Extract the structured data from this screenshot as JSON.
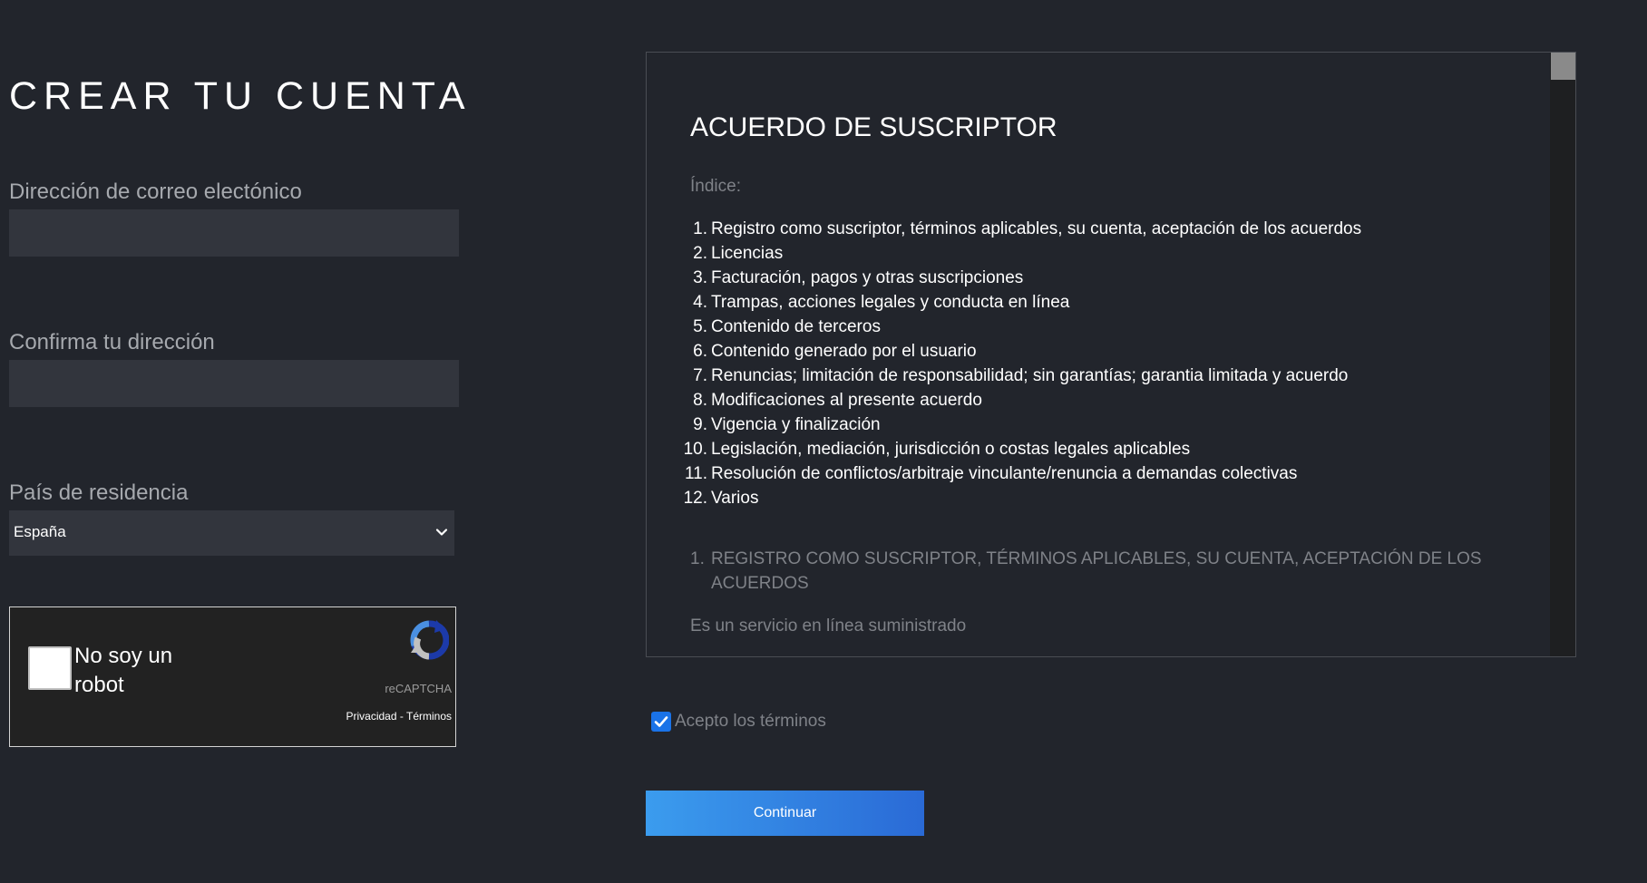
{
  "page": {
    "title": "CREAR TU CUENTA"
  },
  "form": {
    "email_label": "Dirección de correo electónico",
    "email_value": "",
    "confirm_label": "Confirma tu dirección",
    "confirm_value": "",
    "country_label": "País de residencia",
    "country_value": "España"
  },
  "captcha": {
    "label": "No soy un robot",
    "brand": "reCAPTCHA",
    "privacy": "Privacidad",
    "separator": " - ",
    "terms": "Términos",
    "checked": false
  },
  "agreement": {
    "title": "ACUERDO DE SUSCRIPTOR",
    "index_label": "Índice:",
    "items": [
      {
        "num": "1.",
        "text": "Registro como suscriptor, términos aplicables, su cuenta, aceptación de los acuerdos"
      },
      {
        "num": "2.",
        "text": "Licencias"
      },
      {
        "num": "3.",
        "text": "Facturación, pagos y otras suscripciones"
      },
      {
        "num": "4.",
        "text": "Trampas, acciones legales y conducta en línea"
      },
      {
        "num": "5.",
        "text": "Contenido de terceros"
      },
      {
        "num": "6.",
        "text": "Contenido generado por el usuario"
      },
      {
        "num": "7.",
        "text": "Renuncias; limitación de responsabilidad; sin garantías; garantia limitada y acuerdo"
      },
      {
        "num": "8.",
        "text": "Modificaciones al presente acuerdo"
      },
      {
        "num": "9.",
        "text": "Vigencia y finalización"
      },
      {
        "num": "10.",
        "text": "Legislación, mediación, jurisdicción o costas legales aplicables"
      },
      {
        "num": "11.",
        "text": "Resolución de conflictos/arbitraje vinculante/renuncia a demandas colectivas"
      },
      {
        "num": "12.",
        "text": "Varios"
      }
    ],
    "section_num": "1.",
    "section_heading": "REGISTRO COMO SUSCRIPTOR, TÉRMINOS APLICABLES, SU CUENTA, ACEPTACIÓN DE LOS ACUERDOS",
    "section_text": "Es un servicio en línea suministrado"
  },
  "accept": {
    "label": "Acepto los términos",
    "checked": true
  },
  "continue_label": "Continuar",
  "colors": {
    "background": "#22252c",
    "input_bg": "#32353d",
    "accent": "#1a73e8",
    "button_gradient_start": "#3b9cee",
    "button_gradient_end": "#2a6ad6"
  }
}
